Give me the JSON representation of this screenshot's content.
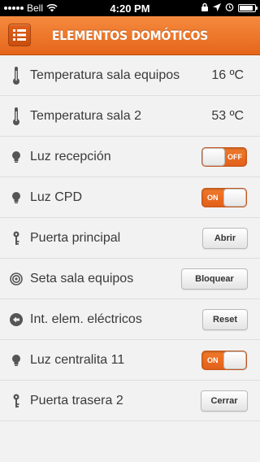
{
  "status_bar": {
    "carrier": "Bell",
    "time": "4:20 PM"
  },
  "nav": {
    "title": "ELEMENTOS DOMÓTICOS",
    "accent_color": "#ec6f23"
  },
  "rows": [
    {
      "icon": "thermometer-icon",
      "label": "Temperatura sala equipos",
      "value": "16 ºC"
    },
    {
      "icon": "thermometer-icon",
      "label": "Temperatura sala 2",
      "value": "53 ºC"
    },
    {
      "icon": "light-bulb-icon",
      "label": "Luz recepción",
      "toggle_label": "OFF",
      "toggle_state": "off"
    },
    {
      "icon": "light-bulb-icon",
      "label": "Luz CPD",
      "toggle_label": "ON",
      "toggle_state": "on"
    },
    {
      "icon": "key-icon",
      "label": "Puerta principal",
      "button": "Abrir"
    },
    {
      "icon": "emergency-stop-icon",
      "label": "Seta sala equipos",
      "button": "Bloquear"
    },
    {
      "icon": "reset-arrow-icon",
      "label": "Int. elem. eléctricos",
      "button": "Reset"
    },
    {
      "icon": "light-bulb-icon",
      "label": "Luz centralita 11",
      "toggle_label": "ON",
      "toggle_state": "on"
    },
    {
      "icon": "key-icon",
      "label": "Puerta trasera 2",
      "button": "Cerrar"
    }
  ]
}
